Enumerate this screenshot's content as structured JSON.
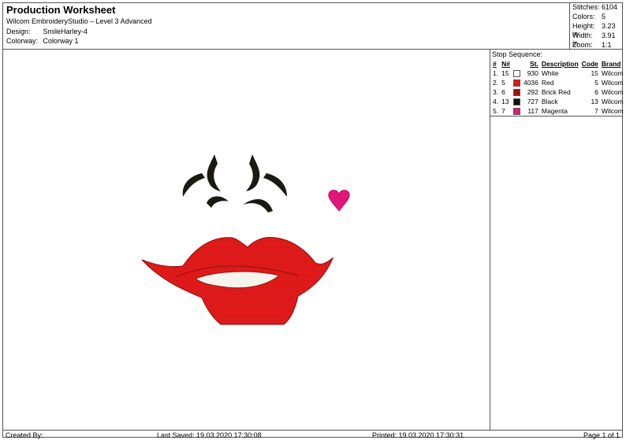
{
  "header": {
    "title": "Production Worksheet",
    "subtitle": "Wilcom EmbroideryStudio – Level 3 Advanced",
    "design_label": "Design:",
    "design_value": "SmileHarley-4",
    "colorway_label": "Colorway:",
    "colorway_value": "Colorway 1"
  },
  "stats": [
    {
      "label": "Stitches:",
      "value": "6104"
    },
    {
      "label": "Colors:",
      "value": "5"
    },
    {
      "label": "Height:",
      "value": "3.23 in"
    },
    {
      "label": "Width:",
      "value": "3.91 in"
    },
    {
      "label": "Zoom:",
      "value": "1:1"
    }
  ],
  "stop_sequence": {
    "caption": "Stop Sequence:",
    "headers": {
      "num": "#",
      "n": "N#",
      "st": "St.",
      "desc": "Description",
      "code": "Code",
      "brand": "Brand"
    },
    "rows": [
      {
        "num": "1.",
        "n": "15",
        "color": "#ffffff",
        "st": "930",
        "desc": "White",
        "code": "15",
        "brand": "Wilcom"
      },
      {
        "num": "2.",
        "n": "5",
        "color": "#e8141b",
        "st": "4036",
        "desc": "Red",
        "code": "5",
        "brand": "Wilcom"
      },
      {
        "num": "3.",
        "n": "6",
        "color": "#a01010",
        "st": "292",
        "desc": "Brick Red",
        "code": "6",
        "brand": "Wilcom"
      },
      {
        "num": "4.",
        "n": "13",
        "color": "#111111",
        "st": "727",
        "desc": "Black",
        "code": "13",
        "brand": "Wilcom"
      },
      {
        "num": "5.",
        "n": "7",
        "color": "#e0167a",
        "st": "117",
        "desc": "Magenta",
        "code": "7",
        "brand": "Wilcom"
      }
    ]
  },
  "footer": {
    "created_by": "Created By:",
    "last_saved": "Last Saved: 19.03.2020 17:30:08",
    "printed": "Printed: 19.03.2020 17:30:31",
    "page": "Page 1 of 1"
  },
  "design_colors": {
    "lips": "#e01a1a",
    "lip_outline": "#a01010",
    "teeth": "#f4f4ec",
    "brows": "#1a1a12",
    "heart": "#e0167a"
  }
}
